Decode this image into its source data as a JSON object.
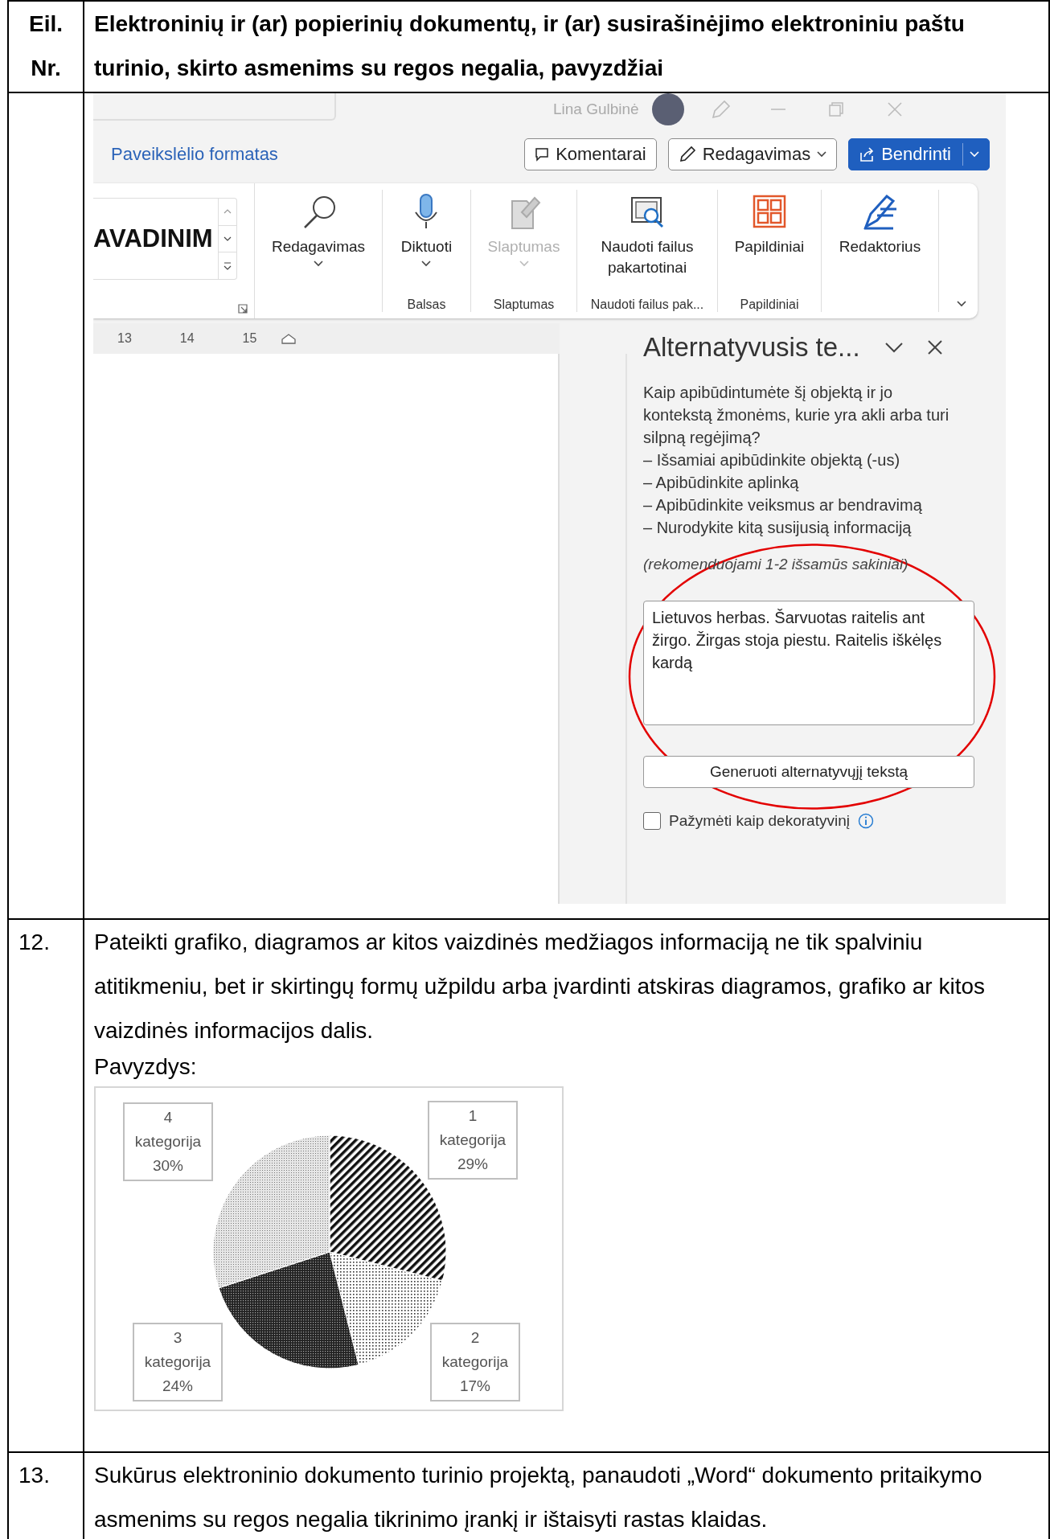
{
  "table": {
    "header": {
      "number": "Eil. Nr.",
      "title": "Elektroninių ir (ar) popierinių dokumentų, ir (ar) susirašinėjimo elektroniniu paštu turinio, skirto asmenims su regos negalia, pavyzdžiai"
    },
    "rows": [
      {
        "kind": "screenshot",
        "number": ""
      },
      {
        "kind": "chart",
        "number": "12.",
        "text": "Pateikti grafiko, diagramos ar kitos vaizdinės medžiagos informaciją ne tik spalviniu atitikmeniu, bet ir skirtingų formų užpildu arba įvardinti atskiras diagramos, grafiko ar kitos vaizdinės informacijos dalis.",
        "example_label": "Pavyzdys:"
      },
      {
        "kind": "text",
        "number": "13.",
        "text": "Sukūrus elektroninio dokumento turinio projektą, panaudoti „Word“ dokumento pritaikymo asmenims su regos negalia tikrinimo įrankį ir ištaisyti rastas klaidas."
      }
    ]
  },
  "word_window": {
    "user_name": "Lina Gulbinė",
    "contextual_tab": "Paveikslėlio formatas",
    "top_buttons": [
      {
        "kind": "comment",
        "label": "Komentarai"
      },
      {
        "kind": "edit",
        "label": "Redagavimas"
      },
      {
        "kind": "share",
        "label": "Bendrinti"
      }
    ],
    "style_gallery_text": "AVADINIM",
    "ribbon_groups": [
      {
        "button": {
          "kind": "search",
          "label": "Redagavimas",
          "dropdown": true,
          "disabled": false
        }
      },
      {
        "label": "Balsas",
        "button": {
          "kind": "mic",
          "label": "Diktuoti",
          "dropdown": true,
          "disabled": false
        }
      },
      {
        "label": "Slaptumas",
        "button": {
          "kind": "privacy",
          "label": "Slaptumas",
          "dropdown": true,
          "disabled": true
        }
      },
      {
        "label": "Naudoti failus pak...",
        "button": {
          "kind": "reuse",
          "label": "Naudoti failus pakartotinai",
          "dropdown": false,
          "disabled": false
        }
      },
      {
        "label": "Papildiniai",
        "button": {
          "kind": "addins",
          "label": "Papildiniai",
          "dropdown": false,
          "disabled": false
        }
      },
      {
        "button": {
          "kind": "editor",
          "label": "Redaktorius",
          "dropdown": false,
          "disabled": false
        }
      }
    ],
    "ruler": [
      "13",
      "14",
      "15"
    ],
    "pane": {
      "title": "Alternatyvusis te...",
      "prompt": "Kaip apibūdintumėte šį objektą ir jo kontekstą žmonėms, kurie yra akli arba turi silpną regėjimą?",
      "tips": [
        "– Išsamiai apibūdinkite objektą (-us)",
        "– Apibūdinkite aplinką",
        "– Apibūdinkite veiksmus ar bendravimą",
        "– Nurodykite kitą susijusią informaciją"
      ],
      "hint": "(rekomenduojami 1-2 išsamūs sakiniai)",
      "alt_text": "Lietuvos herbas. Šarvuotas raitelis ant žirgo. Žirgas stoja piestu. Raitelis iškėlęs kardą",
      "generate_button": "Generuoti alternatyvųjį tekstą",
      "decorative": {
        "label": "Pažymėti kaip dekoratyvinį",
        "checked": false
      }
    }
  },
  "chart_data": {
    "type": "pie",
    "categories": [
      "1 kategorija",
      "2 kategorija",
      "3 kategorija",
      "4 kategorija"
    ],
    "values": [
      29,
      17,
      24,
      30
    ],
    "value_labels": [
      "29%",
      "17%",
      "24%",
      "30%"
    ],
    "data_labels": true
  }
}
